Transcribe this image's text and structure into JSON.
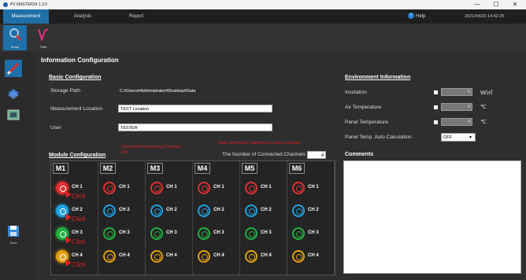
{
  "window": {
    "title": "PV MASTER24 1.3.0",
    "min": "—",
    "max": "☐",
    "close": "✕"
  },
  "menu": {
    "tabs": [
      "Measurement",
      "Analysis",
      "Report"
    ],
    "help": "Help",
    "datetime": "2021/04/20 14:42:25"
  },
  "ribbon": {
    "setup_label": "Setup",
    "time_label": "Time"
  },
  "sidebar": {
    "save_label": "Save"
  },
  "main": {
    "title": "Information Configuration",
    "basic": {
      "heading": "Basic Configuration",
      "storage_label": "Storage Path",
      "storage_value": "C:#Users#Administrator#Desktop#Data",
      "location_label": "Measurement Location",
      "location_value": "TEST Location",
      "user_label": "User",
      "user_value": "TESTER"
    },
    "module": {
      "heading": "Module Configuration",
      "connected_note": "Connected measuring Channel : ON",
      "total_note": "Total connected channels are auto-counted",
      "num_channels_label": "The Number of Connected Channels",
      "num_channels_value": "4",
      "modules": [
        "M1",
        "M2",
        "M3",
        "M4",
        "M5",
        "M6"
      ],
      "channels": [
        "CH 1",
        "CH 2",
        "CH 3",
        "CH 4"
      ],
      "click_label": "Click"
    },
    "environment": {
      "heading": "Environment Information",
      "insolation_label": "Insolation",
      "insolation_value": "0",
      "insolation_unit": "W/㎡",
      "air_label": "Air Temperature",
      "air_value": "0",
      "air_unit": "℃",
      "panel_label": "Panel Temperature",
      "panel_value": "0",
      "panel_unit": "℃",
      "auto_label": "Panel Temp. Auto Calculation",
      "auto_value": "OFF"
    },
    "comments": {
      "heading": "Comments"
    }
  },
  "colors": {
    "ch1": "#e03030",
    "ch2": "#20a0e0",
    "ch3": "#20b040",
    "ch4": "#e0a010",
    "accent": "#1f6fa8",
    "note": "#e02020"
  }
}
